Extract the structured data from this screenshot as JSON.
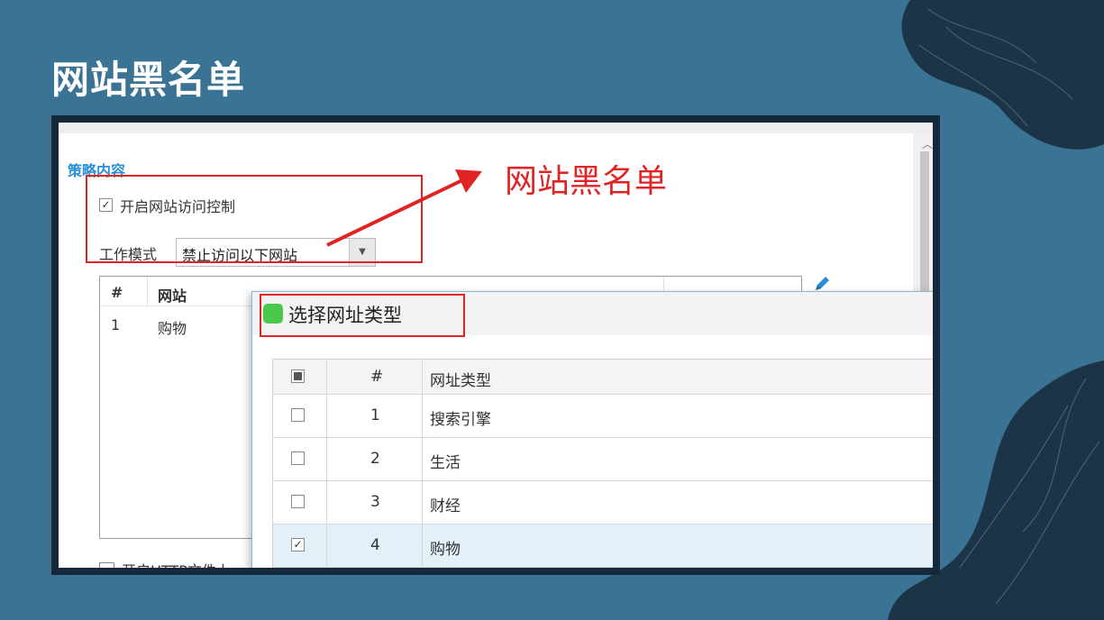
{
  "slide": {
    "title": "网站黑名单",
    "bg_color": "#3b7394"
  },
  "policy": {
    "section_title": "策略内容",
    "enable_access_control": {
      "label": "开启网站访问控制",
      "checked": true
    },
    "work_mode": {
      "label": "工作模式",
      "value": "禁止访问以下网站"
    },
    "annotation": "网站黑名单",
    "list": {
      "columns": [
        "#",
        "网站"
      ],
      "rows": [
        {
          "index": "1",
          "site": "购物"
        }
      ]
    },
    "bottom_checkbox_label": "开启HTTP文件上"
  },
  "dialog": {
    "title": "选择网址类型",
    "columns": [
      "#",
      "网址类型"
    ],
    "header_checkbox": "partial",
    "rows": [
      {
        "index": "1",
        "type": "搜索引擎",
        "checked": false
      },
      {
        "index": "2",
        "type": "生活",
        "checked": false
      },
      {
        "index": "3",
        "type": "财经",
        "checked": false
      },
      {
        "index": "4",
        "type": "购物",
        "checked": true
      }
    ]
  },
  "colors": {
    "accent_red": "#e02424",
    "section_blue": "#2a8fd4",
    "selected_row": "#e4f0f8"
  }
}
